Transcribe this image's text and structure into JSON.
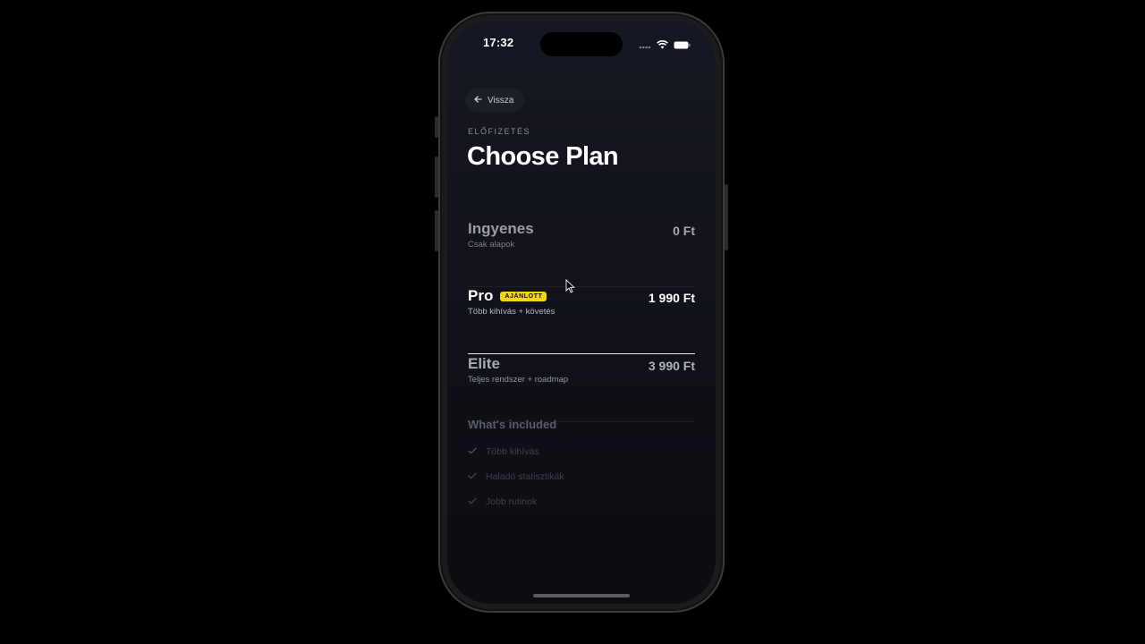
{
  "status_bar": {
    "time": "17:32",
    "icons": [
      "signal-dots-icon",
      "wifi-icon",
      "battery-icon"
    ]
  },
  "nav": {
    "back_label": "Vissza",
    "back_icon": "arrow-left-icon"
  },
  "header": {
    "eyebrow": "ELŐFIZETÉS",
    "title": "Choose Plan"
  },
  "plans": [
    {
      "name": "Ingyenes",
      "subtitle": "Csak alapok",
      "price": "0 Ft",
      "badge": "",
      "selected": false
    },
    {
      "name": "Pro",
      "subtitle": "Több kihívás + követés",
      "price": "1 990 Ft",
      "badge": "AJÁNLOTT",
      "selected": true
    },
    {
      "name": "Elite",
      "subtitle": "Teljes rendszer + roadmap",
      "price": "3 990 Ft",
      "badge": "",
      "selected": false
    }
  ],
  "included": {
    "title": "What's included",
    "items": [
      {
        "label": "Több kihívás",
        "icon": "check-icon"
      },
      {
        "label": "Haladó statisztikák",
        "icon": "check-icon"
      },
      {
        "label": "Jobb rutinok",
        "icon": "check-icon"
      }
    ]
  },
  "colors": {
    "accent_badge": "#f5d31c",
    "background": "#000000",
    "screen_bg": "#12131b"
  }
}
